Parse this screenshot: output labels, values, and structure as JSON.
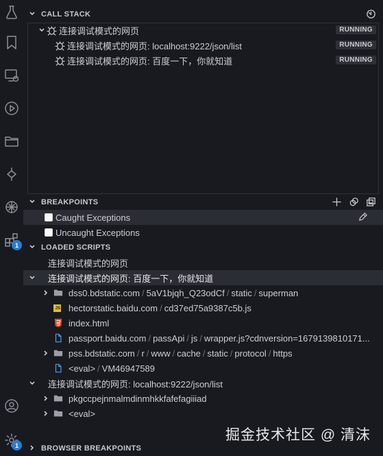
{
  "activity_bar": {
    "items": [
      {
        "name": "flask-icon"
      },
      {
        "name": "bookmark-icon"
      },
      {
        "name": "remote-explorer-icon"
      },
      {
        "name": "run-debug-icon"
      },
      {
        "name": "folder-icon"
      },
      {
        "name": "git-icon"
      },
      {
        "name": "openai-icon"
      },
      {
        "name": "extensions-icon",
        "badge": "1"
      }
    ],
    "bottom": [
      {
        "name": "account-icon"
      },
      {
        "name": "settings-gear-icon",
        "badge": "1"
      }
    ]
  },
  "call_stack": {
    "title": "CALL STACK",
    "root": {
      "label": "连接调试模式的网页",
      "status": "RUNNING"
    },
    "children": [
      {
        "label": "连接调试模式的网页: localhost:9222/json/list",
        "status": "RUNNING"
      },
      {
        "label": "连接调试模式的网页: 百度一下，你就知道",
        "status": "RUNNING"
      }
    ]
  },
  "breakpoints": {
    "title": "BREAKPOINTS",
    "items": [
      {
        "label": "Caught Exceptions",
        "checked": false
      },
      {
        "label": "Uncaught Exceptions",
        "checked": false
      }
    ]
  },
  "loaded_scripts": {
    "title": "LOADED SCRIPTS",
    "session1": "连接调试模式的网页",
    "session2": "连接调试模式的网页: 百度一下，你就知道",
    "session3": "连接调试模式的网页: localhost:9222/json/list",
    "files": {
      "dss": {
        "seg1": "dss0.bdstatic.com",
        "seg2": "5aV1bjqh_Q23odCf",
        "seg3": "static",
        "seg4": "superman"
      },
      "hector": {
        "seg1": "hectorstatic.baidu.com",
        "seg2": "cd37ed75a9387c5b.js"
      },
      "index": {
        "label": "index.html"
      },
      "passport": {
        "seg1": "passport.baidu.com",
        "seg2": "passApi",
        "seg3": "js",
        "seg4": "wrapper.js?cdnversion=1679139810171..."
      },
      "pss": {
        "seg1": "pss.bdstatic.com",
        "seg2": "r",
        "seg3": "www",
        "seg4": "cache",
        "seg5": "static",
        "seg6": "protocol",
        "seg7": "https"
      },
      "eval": {
        "seg1": "<eval>",
        "seg2": "VM46947589"
      },
      "pkg": {
        "label": "pkgccpejnmalmdinmhkkfafefagiiiad"
      },
      "eval2": {
        "label": "<eval>"
      }
    }
  },
  "browser_breakpoints": {
    "title": "BROWSER BREAKPOINTS"
  },
  "watermark": "掘金技术社区 @ 清沫",
  "colors": {
    "accent_badge": "#2b7cd3",
    "js_icon": "#e0b93a",
    "html_icon": "#e44d26",
    "doc_icon": "#4c9cf0"
  }
}
